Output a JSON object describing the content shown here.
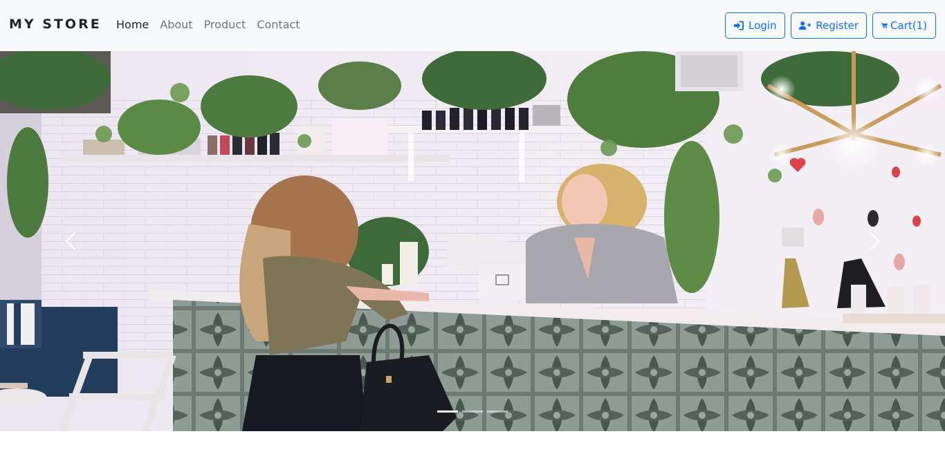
{
  "navbar": {
    "brand": "MY STORE",
    "links": [
      {
        "label": "Home",
        "active": true
      },
      {
        "label": "About",
        "active": false
      },
      {
        "label": "Product",
        "active": false
      },
      {
        "label": "Contact",
        "active": false
      }
    ],
    "actions": {
      "login_label": "Login",
      "login_icon": "sign-in-icon",
      "register_label": "Register",
      "register_icon": "user-plus-icon",
      "cart_label": "Cart(1)",
      "cart_icon": "shopping-cart-icon"
    }
  },
  "carousel": {
    "slide_count": 3,
    "active_slide": 1,
    "prev_icon": "chevron-left-icon",
    "next_icon": "chevron-right-icon"
  },
  "colors": {
    "navbar_bg": "#f8f9fa",
    "accent": "#0d6efd",
    "brand_text": "#212529",
    "muted_link": "#6c757d"
  }
}
